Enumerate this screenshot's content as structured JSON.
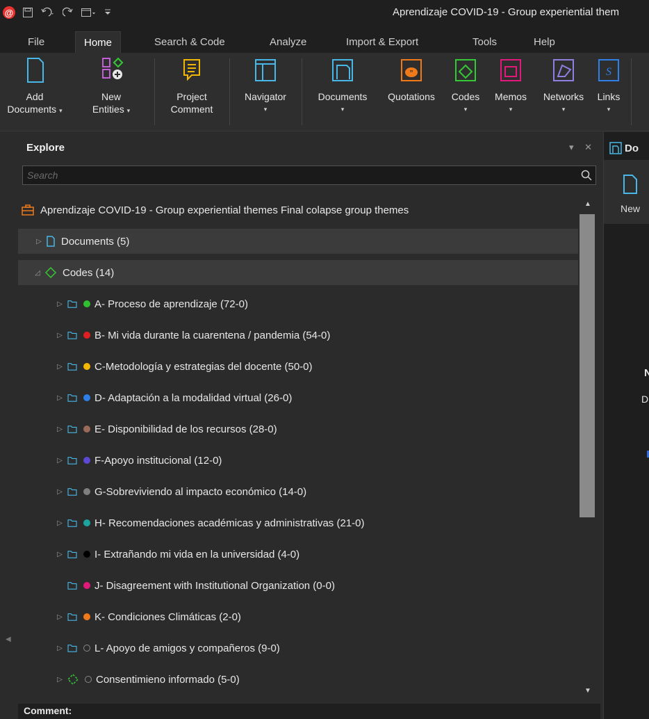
{
  "window": {
    "title": "Aprendizaje COVID-19 - Group experiential them",
    "app_logo": "@",
    "qat_icons": [
      "save-icon",
      "undo-icon",
      "redo-icon",
      "window-icon",
      "customize-icon"
    ]
  },
  "tabs": [
    {
      "label": "File"
    },
    {
      "label": "Home"
    },
    {
      "label": "Search & Code"
    },
    {
      "label": "Analyze"
    },
    {
      "label": "Import & Export"
    },
    {
      "label": "Tools"
    },
    {
      "label": "Help"
    }
  ],
  "ribbon": {
    "add_documents": {
      "line1": "Add",
      "line2": "Documents",
      "caret": "▾"
    },
    "new_entities": {
      "line1": "New",
      "line2": "Entities",
      "caret": "▾"
    },
    "project_comment": {
      "line1": "Project",
      "line2": "Comment"
    },
    "navigator": {
      "label": "Navigator",
      "caret": "▾"
    },
    "documents": {
      "label": "Documents",
      "caret": "▾"
    },
    "quotations": {
      "label": "Quotations"
    },
    "codes": {
      "label": "Codes",
      "caret": "▾"
    },
    "memos": {
      "label": "Memos",
      "caret": "▾"
    },
    "networks": {
      "label": "Networks",
      "caret": "▾"
    },
    "links": {
      "label": "Links",
      "caret": "▾"
    }
  },
  "explore": {
    "title": "Explore",
    "controls": "▾ ✕",
    "search_placeholder": "Search",
    "root": "Aprendizaje COVID-19 - Group experiential themes Final colapse group themes",
    "documents": "Documents (5)",
    "codes": "Codes (14)",
    "code_items": [
      {
        "label": "A- Proceso de aprendizaje (72-0)",
        "color": "#2fbf2f",
        "expander": "▷"
      },
      {
        "label": "B- Mi vida durante la cuarentena / pandemia (54-0)",
        "color": "#e02020",
        "expander": "▷"
      },
      {
        "label": "C-Metodología y estrategias del docente (50-0)",
        "color": "#f2b705",
        "expander": "▷"
      },
      {
        "label": "D- Adaptación a la modalidad virtual (26-0)",
        "color": "#2f7fe8",
        "expander": "▷"
      },
      {
        "label": "E- Disponibilidad de los recursos (28-0)",
        "color": "#9c6a5a",
        "expander": "▷"
      },
      {
        "label": "F-Apoyo institucional (12-0)",
        "color": "#5b49d6",
        "expander": "▷"
      },
      {
        "label": "G-Sobreviviendo al impacto económico (14-0)",
        "color": "#7f7f7f",
        "expander": "▷"
      },
      {
        "label": "H- Recomendaciones académicas y administrativas (21-0)",
        "color": "#1aa5a0",
        "expander": "▷"
      },
      {
        "label": "I- Extrañando mi vida en la universidad (4-0)",
        "color": "#000000",
        "expander": "▷"
      },
      {
        "label": "J- Disagreement with Institutional Organization (0-0)",
        "color": "#e0197a",
        "expander": ""
      },
      {
        "label": "K-  Condiciones Climáticas (2-0)",
        "color": "#f07a1a",
        "expander": "▷"
      },
      {
        "label": "L- Apoyo de amigos y compañeros (9-0)",
        "color": "hollow",
        "expander": "▷"
      }
    ],
    "last_item": "Consentimieno informado (5-0)",
    "comment_label": "Comment:"
  },
  "right_panel": {
    "tab_label": "Do",
    "new_label": "New",
    "n_text": "N",
    "dra_text": "Dra"
  }
}
